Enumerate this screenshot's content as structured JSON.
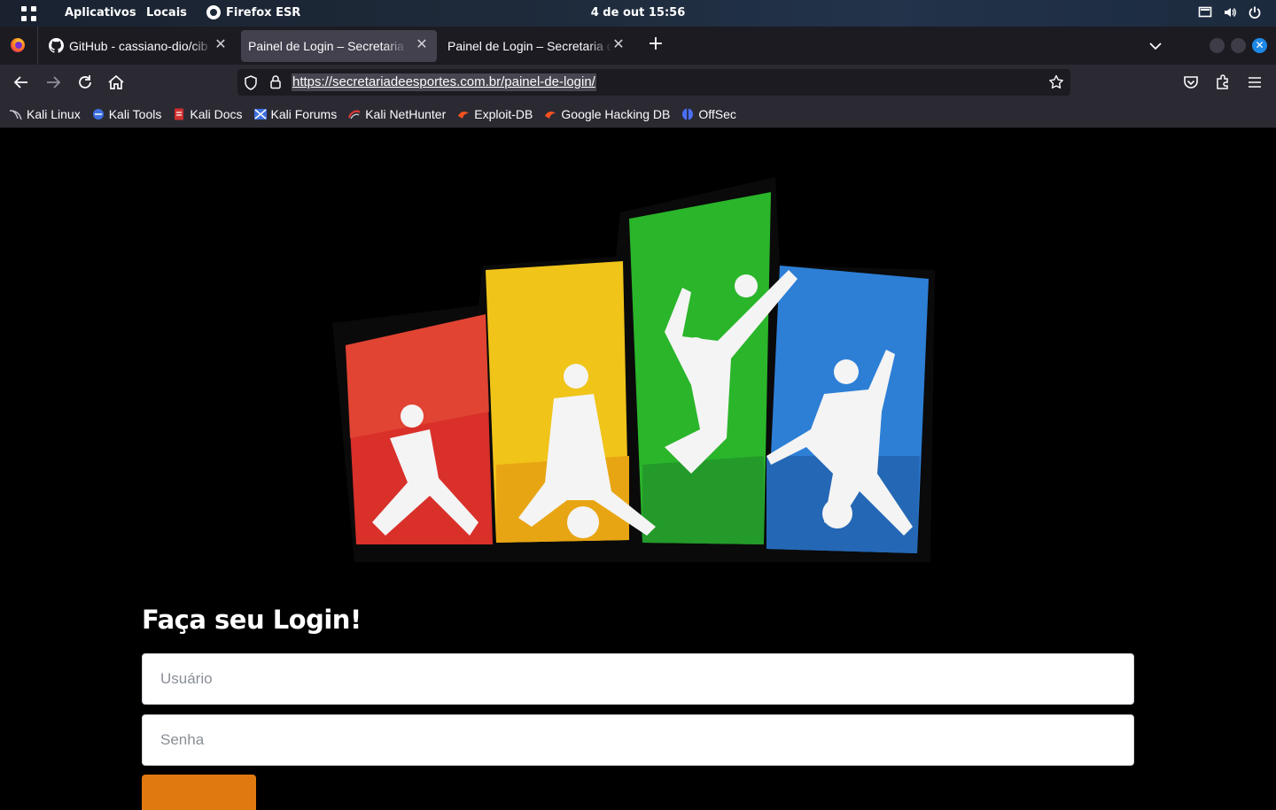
{
  "topbar": {
    "apps_menu": "Aplicativos",
    "places_menu": "Locais",
    "active_app": "Firefox ESR",
    "clock": "4 de out  15:56"
  },
  "tabs": [
    {
      "title": "GitHub - cassiano-dio/cib",
      "icon": "github-icon",
      "active": false
    },
    {
      "title": "Painel de Login – Secretaria d",
      "icon": null,
      "active": true
    },
    {
      "title": "Painel de Login – Secretaria d",
      "icon": null,
      "active": false
    }
  ],
  "navbar": {
    "url": "https://secretariadeesportes.com.br/painel-de-login/"
  },
  "bookmarks": [
    {
      "label": "Kali Linux",
      "icon": "kali-dragon-icon"
    },
    {
      "label": "Kali Tools",
      "icon": "kali-tools-icon"
    },
    {
      "label": "Kali Docs",
      "icon": "kali-docs-icon"
    },
    {
      "label": "Kali Forums",
      "icon": "kali-forums-icon"
    },
    {
      "label": "Kali NetHunter",
      "icon": "kali-nethunter-icon"
    },
    {
      "label": "Exploit-DB",
      "icon": "exploit-db-icon"
    },
    {
      "label": "Google Hacking DB",
      "icon": "ghdb-icon"
    },
    {
      "label": "OffSec",
      "icon": "offsec-icon"
    }
  ],
  "colors": {
    "accent_button": "#e07a10",
    "page_background": "#000000",
    "logo_panels": [
      "#d9302a",
      "#f0c419",
      "#2ab52a",
      "#2d7fd6"
    ]
  },
  "login": {
    "title": "Faça seu Login!",
    "username_placeholder": "Usuário",
    "password_placeholder": "Senha"
  }
}
